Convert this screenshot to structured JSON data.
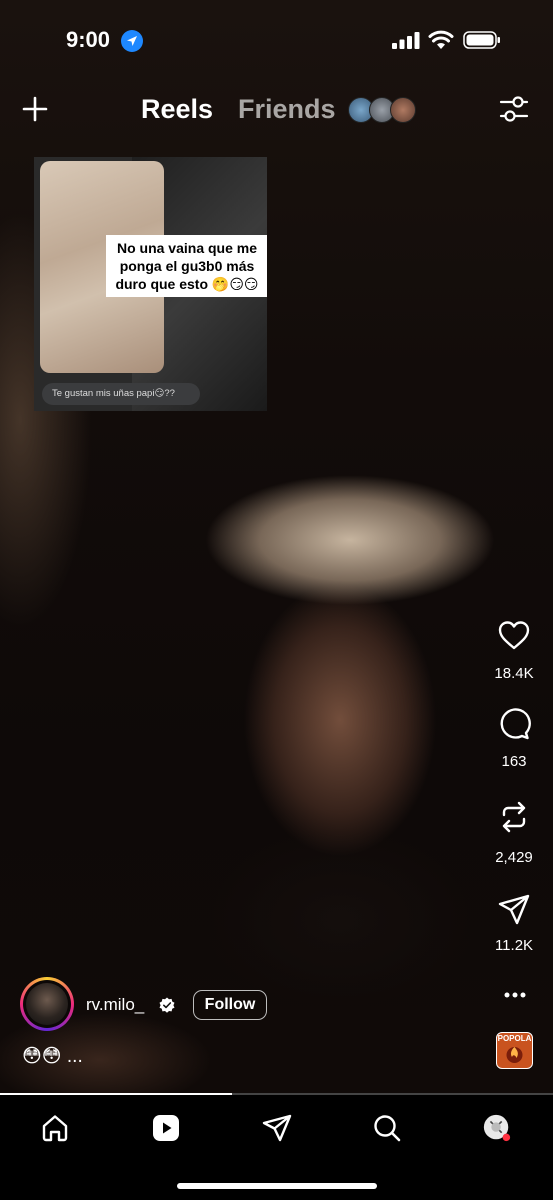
{
  "status_bar": {
    "time": "9:00"
  },
  "header": {
    "tabs": [
      {
        "label": "Reels",
        "active": true
      },
      {
        "label": "Friends",
        "active": false
      }
    ]
  },
  "card": {
    "overlay_text": "No una vaina que me ponga el gu3b0 más duro que esto 🤭😏😏",
    "bubble_text": "Te gustan mis uñas papi😏??"
  },
  "actions": {
    "likes": "18.4K",
    "comments": "163",
    "reposts": "2,429",
    "shares": "11.2K"
  },
  "post": {
    "username": "rv.milo_",
    "follow_label": "Follow",
    "caption": "😳😳 ...",
    "audio_label": "POPOLA"
  },
  "progress": {
    "fraction": 0.42
  },
  "colors": {
    "accent": "#ee2a7b",
    "active_tab": "#ffffff",
    "inactive_tab": "#a9a6a4",
    "notification_dot": "#ff3040"
  }
}
